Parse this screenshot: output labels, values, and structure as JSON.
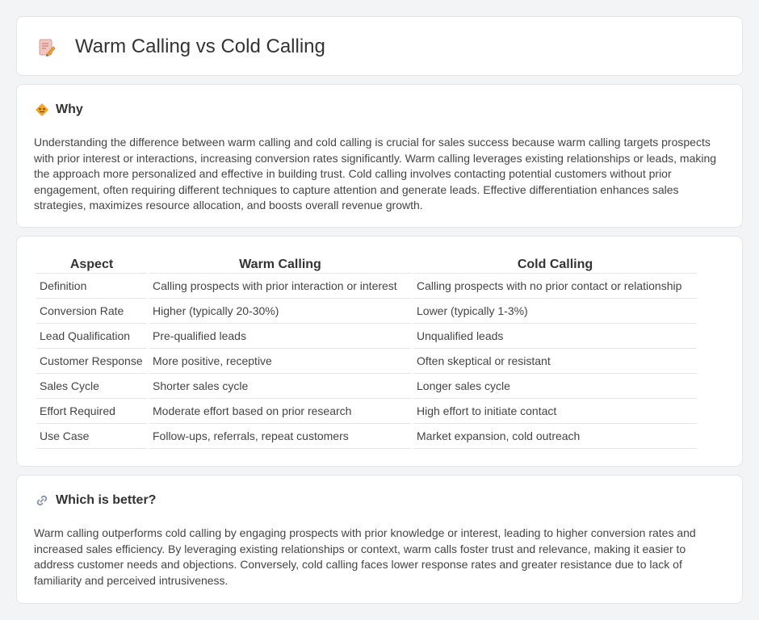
{
  "header": {
    "title": "Warm Calling vs Cold Calling",
    "icon": "document-pencil-icon"
  },
  "why": {
    "heading": "Why",
    "icon": "diamond-warning-icon",
    "text": "Understanding the difference between warm calling and cold calling is crucial for sales success because warm calling targets prospects with prior interest or interactions, increasing conversion rates significantly. Warm calling leverages existing relationships or leads, making the approach more personalized and effective in building trust. Cold calling involves contacting potential customers without prior engagement, often requiring different techniques to capture attention and generate leads. Effective differentiation enhances sales strategies, maximizes resource allocation, and boosts overall revenue growth."
  },
  "table": {
    "headers": [
      "Aspect",
      "Warm Calling",
      "Cold Calling"
    ],
    "rows": [
      [
        "Definition",
        "Calling prospects with prior interaction or interest",
        "Calling prospects with no prior contact or relationship"
      ],
      [
        "Conversion Rate",
        "Higher (typically 20-30%)",
        "Lower (typically 1-3%)"
      ],
      [
        "Lead Qualification",
        "Pre-qualified leads",
        "Unqualified leads"
      ],
      [
        "Customer Response",
        "More positive, receptive",
        "Often skeptical or resistant"
      ],
      [
        "Sales Cycle",
        "Shorter sales cycle",
        "Longer sales cycle"
      ],
      [
        "Effort Required",
        "Moderate effort based on prior research",
        "High effort to initiate contact"
      ],
      [
        "Use Case",
        "Follow-ups, referrals, repeat customers",
        "Market expansion, cold outreach"
      ]
    ]
  },
  "better": {
    "heading": "Which is better?",
    "icon": "link-icon",
    "text": "Warm calling outperforms cold calling by engaging prospects with prior knowledge or interest, leading to higher conversion rates and increased sales efficiency. By leveraging existing relationships or context, warm calls foster trust and relevance, making it easier to address customer needs and objections. Conversely, cold calling faces lower response rates and greater resistance due to lack of familiarity and perceived intrusiveness."
  },
  "colors": {
    "background": "#f3f4f6",
    "card": "#ffffff",
    "accent_orange": "#f5a623",
    "icon_pink": "#e8837a"
  }
}
